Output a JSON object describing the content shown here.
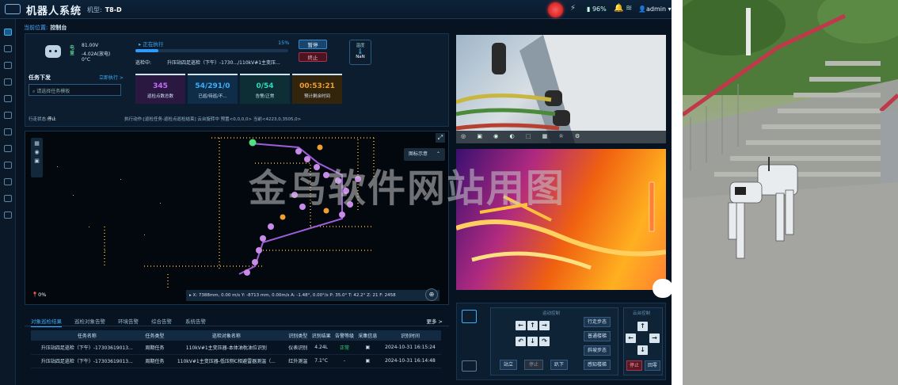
{
  "app": {
    "title": "机器人系统",
    "model_label": "机型:",
    "model": "T8-D",
    "battery": "96%",
    "user": "admin"
  },
  "breadcrumb": {
    "label": "当前位置:",
    "value": "控制台"
  },
  "robot_status": {
    "voltage": "81.00V",
    "current": "-4.02A(放电)",
    "temp": "0°C",
    "battery_label": "电量",
    "state": "正在执行",
    "progress_pct": "15%",
    "progress_value": 15,
    "task_label": "巡检中:",
    "task_name": "升压站四足巡检（下午）-1730.../110kV#1主变压...",
    "pause": "暂停",
    "stop": "终止",
    "temp_box_label": "温度",
    "temp_box_value": "NaN"
  },
  "tasks": {
    "title": "任务下发",
    "link": "立即执行 >",
    "search_placeholder": "请选择任务模板"
  },
  "stats": [
    {
      "value": "345",
      "label": "巡检点数总数",
      "color": "#c86bff"
    },
    {
      "value": "54/291/0",
      "label": "已巡/待巡/不...",
      "color": "#3ab0ff"
    },
    {
      "value": "0/54",
      "label": "告警/正常",
      "color": "#2edcc0"
    },
    {
      "value": "00:53:21",
      "label": "预计剩余时间",
      "color": "#f0a030"
    }
  ],
  "footer_status": {
    "walk_label": "行走状态:",
    "walk": "停止",
    "exec_label": "执行动作:",
    "exec": "[巡检任务-巡检点巡检结束] 云台旋转中 预置<0,0,0,0> 当前<4223,0,3505,0>"
  },
  "map": {
    "legend": "图标示意",
    "battery_pct": "0%",
    "coords": "X: 7388mm, 0.00 m/s   Y: -8713 mm, 0.00m/s   A: -1.48°, 0.00°/s   P: 35.0°   T: 42.2°   Z: 21   F: 2458"
  },
  "watermark": "金鸟软件网站用图",
  "tabs": [
    "对象巡检结果",
    "巡检对象告警",
    "环境告警",
    "综合告警",
    "系统告警"
  ],
  "more": "更多 >",
  "table": {
    "headers": [
      "任务名称",
      "任务类型",
      "巡检对象名称",
      "识别类型",
      "识别结果",
      "告警等级",
      "采集信息",
      "识别时间"
    ],
    "rows": [
      [
        "升压站四足巡检（下午）-17303619013...",
        "周期任务",
        "110kV#1主变压器-本体油枕油位识别",
        "仪表识别",
        "4.24L",
        "正常",
        "▣",
        "2024-10-31 16:15:24"
      ],
      [
        "升压站四足巡检（下午）-17303619013...",
        "周期任务",
        "110kV#1主变压器-低压侧C相避雷器测温（...",
        "红外测温",
        "7.1°C",
        "-",
        "▣",
        "2024-10-31 16:14:48"
      ]
    ]
  },
  "control": {
    "gait_title": "运动控制",
    "head_title": "云台控制",
    "gaits": [
      "行走步态",
      "普通楼梯",
      "斜坡步态",
      "感知楼梯"
    ],
    "stand": "站立",
    "stop": "停止",
    "lie": "趴下",
    "halt": "停止",
    "reset": "回零"
  }
}
